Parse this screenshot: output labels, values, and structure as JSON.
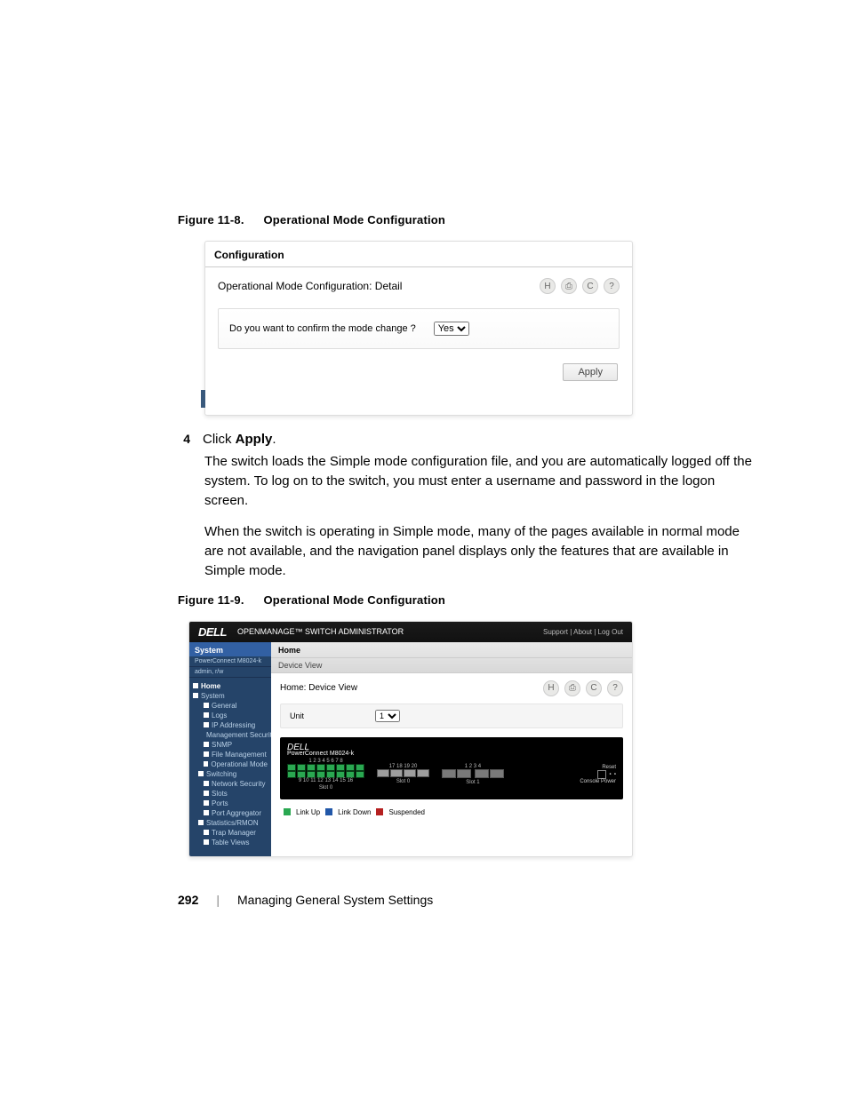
{
  "figure8": {
    "caption_num": "Figure 11-8.",
    "caption_text": "Operational Mode Configuration",
    "header_tab": "Configuration",
    "title": "Operational Mode Configuration: Detail",
    "question": "Do you want to confirm the mode change ?",
    "select_value": "Yes",
    "apply_label": "Apply"
  },
  "step4": {
    "num": "4",
    "prefix": "Click ",
    "bold": "Apply",
    "suffix": "."
  },
  "para1": "The switch loads the Simple mode configuration file, and you are automatically logged off the system. To log on to the switch, you must enter a username and password in the logon screen.",
  "para2": "When the switch is operating in Simple mode, many of the pages available in normal mode are not available, and the navigation panel displays only the features that are available in Simple mode.",
  "figure9": {
    "caption_num": "Figure 11-9.",
    "caption_text": "Operational Mode Configuration",
    "topbar_app": "OPENMANAGE™ SWITCH ADMINISTRATOR",
    "topbar_right": "Support | About | Log Out",
    "side_header": "System",
    "side_device": "PowerConnect M8024-k",
    "side_user": "admin, r/w",
    "nav": [
      {
        "t": "Home",
        "root": true,
        "i": "minus"
      },
      {
        "t": "System",
        "i": "minus"
      },
      {
        "t": "General",
        "i": "plus",
        "indent": 2
      },
      {
        "t": "Logs",
        "i": "plus",
        "indent": 2
      },
      {
        "t": "IP Addressing",
        "i": "plus",
        "indent": 2
      },
      {
        "t": "Management Security",
        "i": "plus",
        "indent": 2
      },
      {
        "t": "SNMP",
        "i": "plus",
        "indent": 2
      },
      {
        "t": "File Management",
        "i": "plus",
        "indent": 2
      },
      {
        "t": "Operational Mode",
        "i": "plus",
        "indent": 2
      },
      {
        "t": "Switching",
        "i": "minus",
        "indent": 1
      },
      {
        "t": "Network Security",
        "i": "plus",
        "indent": 2
      },
      {
        "t": "Slots",
        "i": "plus",
        "indent": 2
      },
      {
        "t": "Ports",
        "i": "plus",
        "indent": 2
      },
      {
        "t": "Port Aggregator",
        "i": "plus",
        "indent": 2
      },
      {
        "t": "Statistics/RMON",
        "i": "minus",
        "indent": 1
      },
      {
        "t": "Trap Manager",
        "i": "plus",
        "indent": 2
      },
      {
        "t": "Table Views",
        "i": "plus",
        "indent": 2
      }
    ],
    "crumb1": "Home",
    "crumb2": "Device View",
    "panel_title": "Home: Device View",
    "unit_label": "Unit",
    "unit_value": "1",
    "device_brand": "DELL",
    "device_model": "PowerConnect M8024-k",
    "port_top_labels": "1  2  3  4  5  6  7  8",
    "port_bottom_labels": "9  10  11  12  13  14  15  16",
    "big_labels": "17  18  19  20",
    "slot0": "Slot 0",
    "slot_alt_labels": "1  2  3  4",
    "slot1": "Slot 1",
    "dev_right1": "Reset",
    "dev_right2": "Console  Power",
    "legend_up": "Link Up",
    "legend_down": "Link Down",
    "legend_susp": "Suspended"
  },
  "footer": {
    "page": "292",
    "sep": "|",
    "chapter": "Managing General System Settings"
  },
  "icons": {
    "save": "H",
    "print": "⎙",
    "refresh": "C",
    "help": "?"
  }
}
